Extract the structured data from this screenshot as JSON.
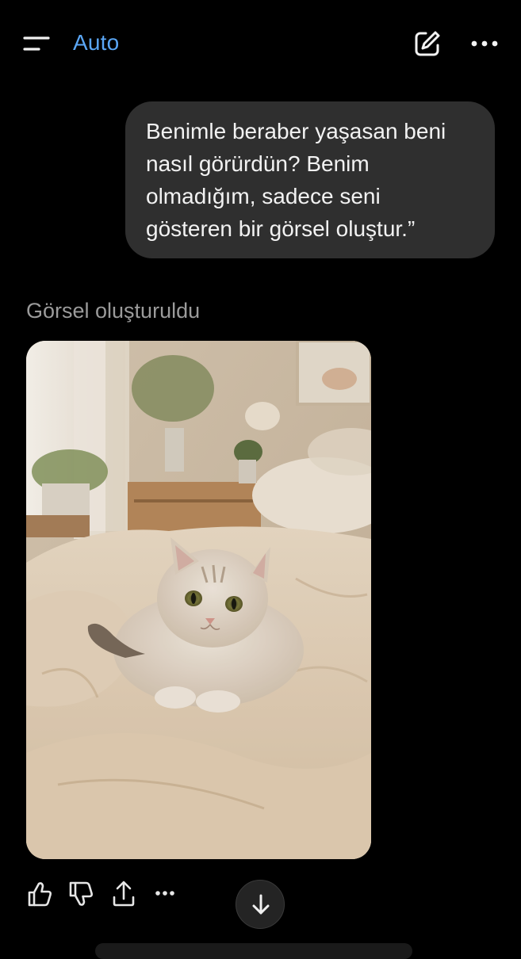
{
  "header": {
    "menu_icon": "menu-lines-icon",
    "model_label": "Auto",
    "edit_icon": "new-chat-edit-icon",
    "more_icon": "more-horizontal-icon"
  },
  "conversation": {
    "user_message": {
      "lines": [
        "Benimle beraber yaşasan beni",
        "nasıl görürdün? Benim",
        "olmadığım, sadece seni",
        "gösteren bir görsel oluştur.”"
      ]
    },
    "assistant": {
      "status": "Görsel oluşturuldu",
      "image_subject": "cream cat lying on a beige duvet in a cozy bedroom"
    }
  },
  "actions": {
    "icons": [
      "thumbs-up-icon",
      "thumbs-down-icon",
      "share-icon",
      "more-horizontal-icon"
    ]
  },
  "scroll_button": {
    "icon": "arrow-down-icon"
  },
  "colors": {
    "background": "#000000",
    "accent": "#5aa6f5",
    "bubble": "#2f2f2f",
    "muted_text": "#9b9b9b"
  }
}
